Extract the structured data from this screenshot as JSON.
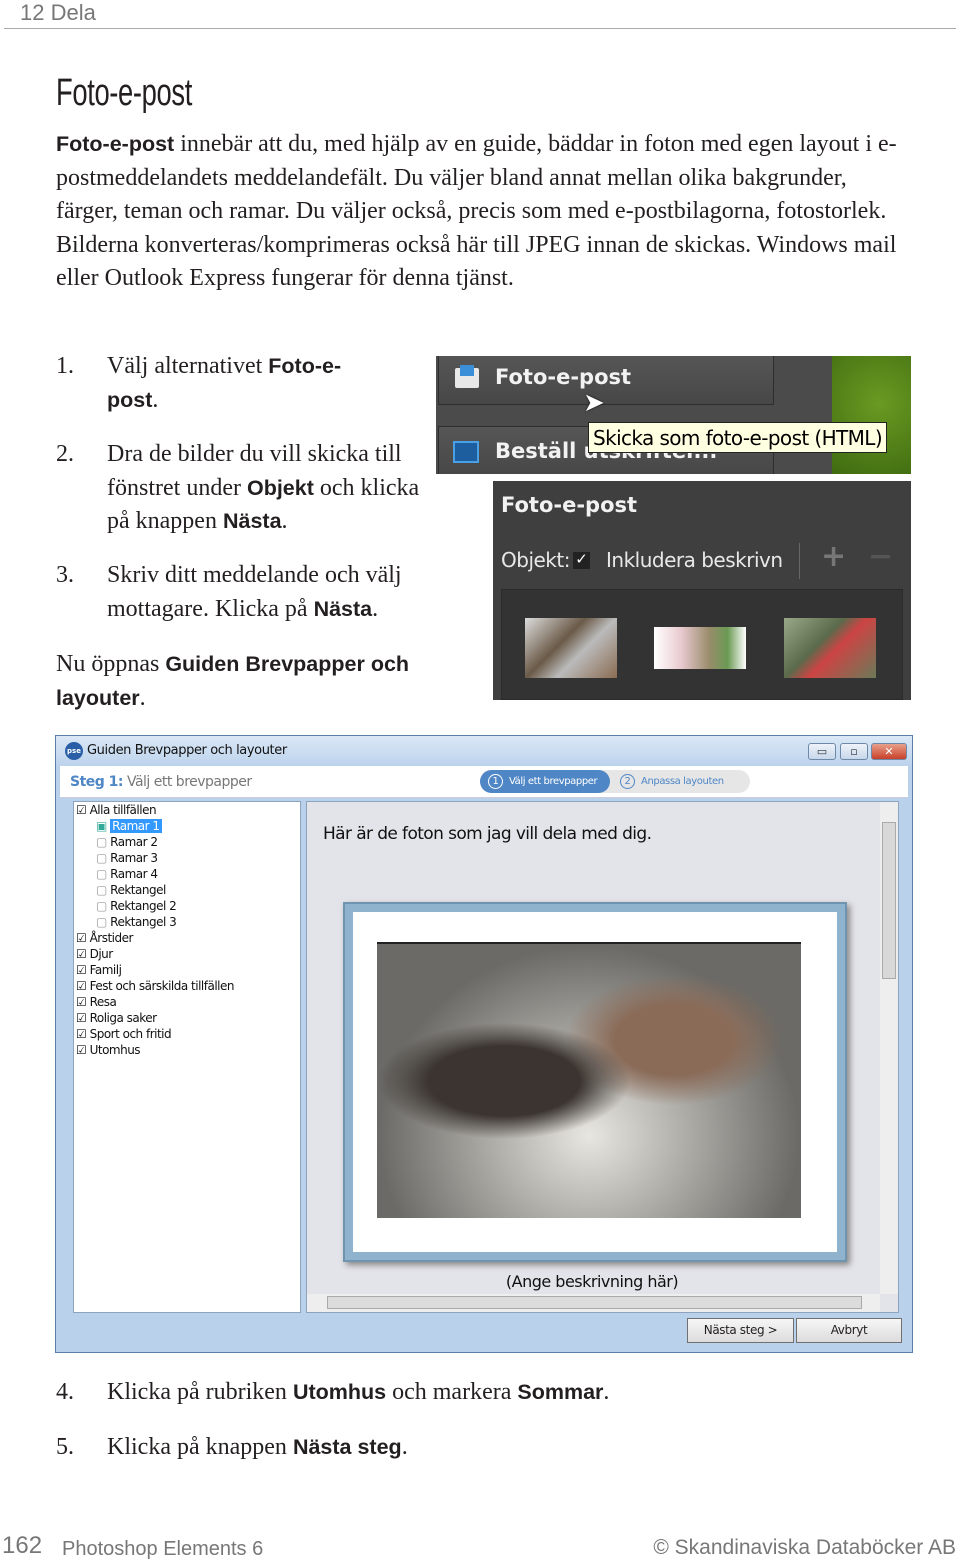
{
  "header": {
    "chapter": "12 Dela"
  },
  "title": "Foto-e-post",
  "intro": {
    "bold": "Foto-e-post",
    "text": " innebär att du, med hjälp av en guide, bäddar in foton med egen layout i e-postmeddelandets meddelandefält. Du väljer bland annat mellan olika bakgrunder, färger, teman och ramar. Du väljer också, precis som med e-postbilagorna, fotostorlek. Bilderna konverteras/komprimeras också här till JPEG innan de skickas. Windows mail eller Outlook Express fungerar för denna tjänst."
  },
  "steps": [
    {
      "n": "1.",
      "a": "Välj alternativet ",
      "b": "Foto-e-post",
      "c": "."
    },
    {
      "n": "2.",
      "a": "Dra de bilder du vill skicka till fönstret under ",
      "b": "Objekt",
      "c": " och klicka på knappen ",
      "d": "Nästa",
      "e": "."
    },
    {
      "n": "3.",
      "a": "Skriv ditt meddelande och välj mottagare. Klicka på ",
      "b": "Nästa",
      "c": "."
    }
  ],
  "after": {
    "a": "Nu öppnas ",
    "b": "Guiden Brevpapper och layouter",
    "c": "."
  },
  "shot1": {
    "button1": "Foto-e-post",
    "button2": "Beställ utskrifter...",
    "tooltip": "Skicka som foto-e-post (HTML)"
  },
  "shot2": {
    "title": "Foto-e-post",
    "objekt": "Objekt:",
    "include": "Inkludera beskrivn",
    "add": "+",
    "remove": "−"
  },
  "dialog": {
    "title": "Guiden Brevpapper och layouter",
    "app_icon": "pse",
    "step_prefix": "Steg 1:",
    "step_text": " Välj ett brevpapper",
    "wizard_steps": [
      {
        "n": "1",
        "label": "Välj ett brevpapper",
        "active": true
      },
      {
        "n": "2",
        "label": "Anpassa layouten",
        "active": false
      }
    ],
    "tree": {
      "root": "Alla tillfällen",
      "children": [
        "Ramar 1",
        "Ramar 2",
        "Ramar 3",
        "Ramar 4",
        "Rektangel",
        "Rektangel 2",
        "Rektangel 3"
      ],
      "selected": "Ramar 1",
      "categories": [
        "Årstider",
        "Djur",
        "Familj",
        "Fest och särskilda tillfällen",
        "Resa",
        "Roliga saker",
        "Sport och fritid",
        "Utomhus"
      ]
    },
    "message": "Här är de foton som jag vill dela med dig.",
    "caption": "(Ange beskrivning här)",
    "next": "Nästa steg >",
    "cancel": "Avbryt",
    "accent": "#4f86c6"
  },
  "steps2": [
    {
      "n": "4.",
      "a": "Klicka på rubriken ",
      "b": "Utomhus",
      "c": " och markera ",
      "d": "Sommar",
      "e": "."
    },
    {
      "n": "5.",
      "a": "Klicka på knappen ",
      "b": "Nästa steg",
      "c": "."
    }
  ],
  "footer": {
    "page": "162",
    "book": "Photoshop Elements 6",
    "copyright": "© Skandinaviska Databöcker AB"
  }
}
